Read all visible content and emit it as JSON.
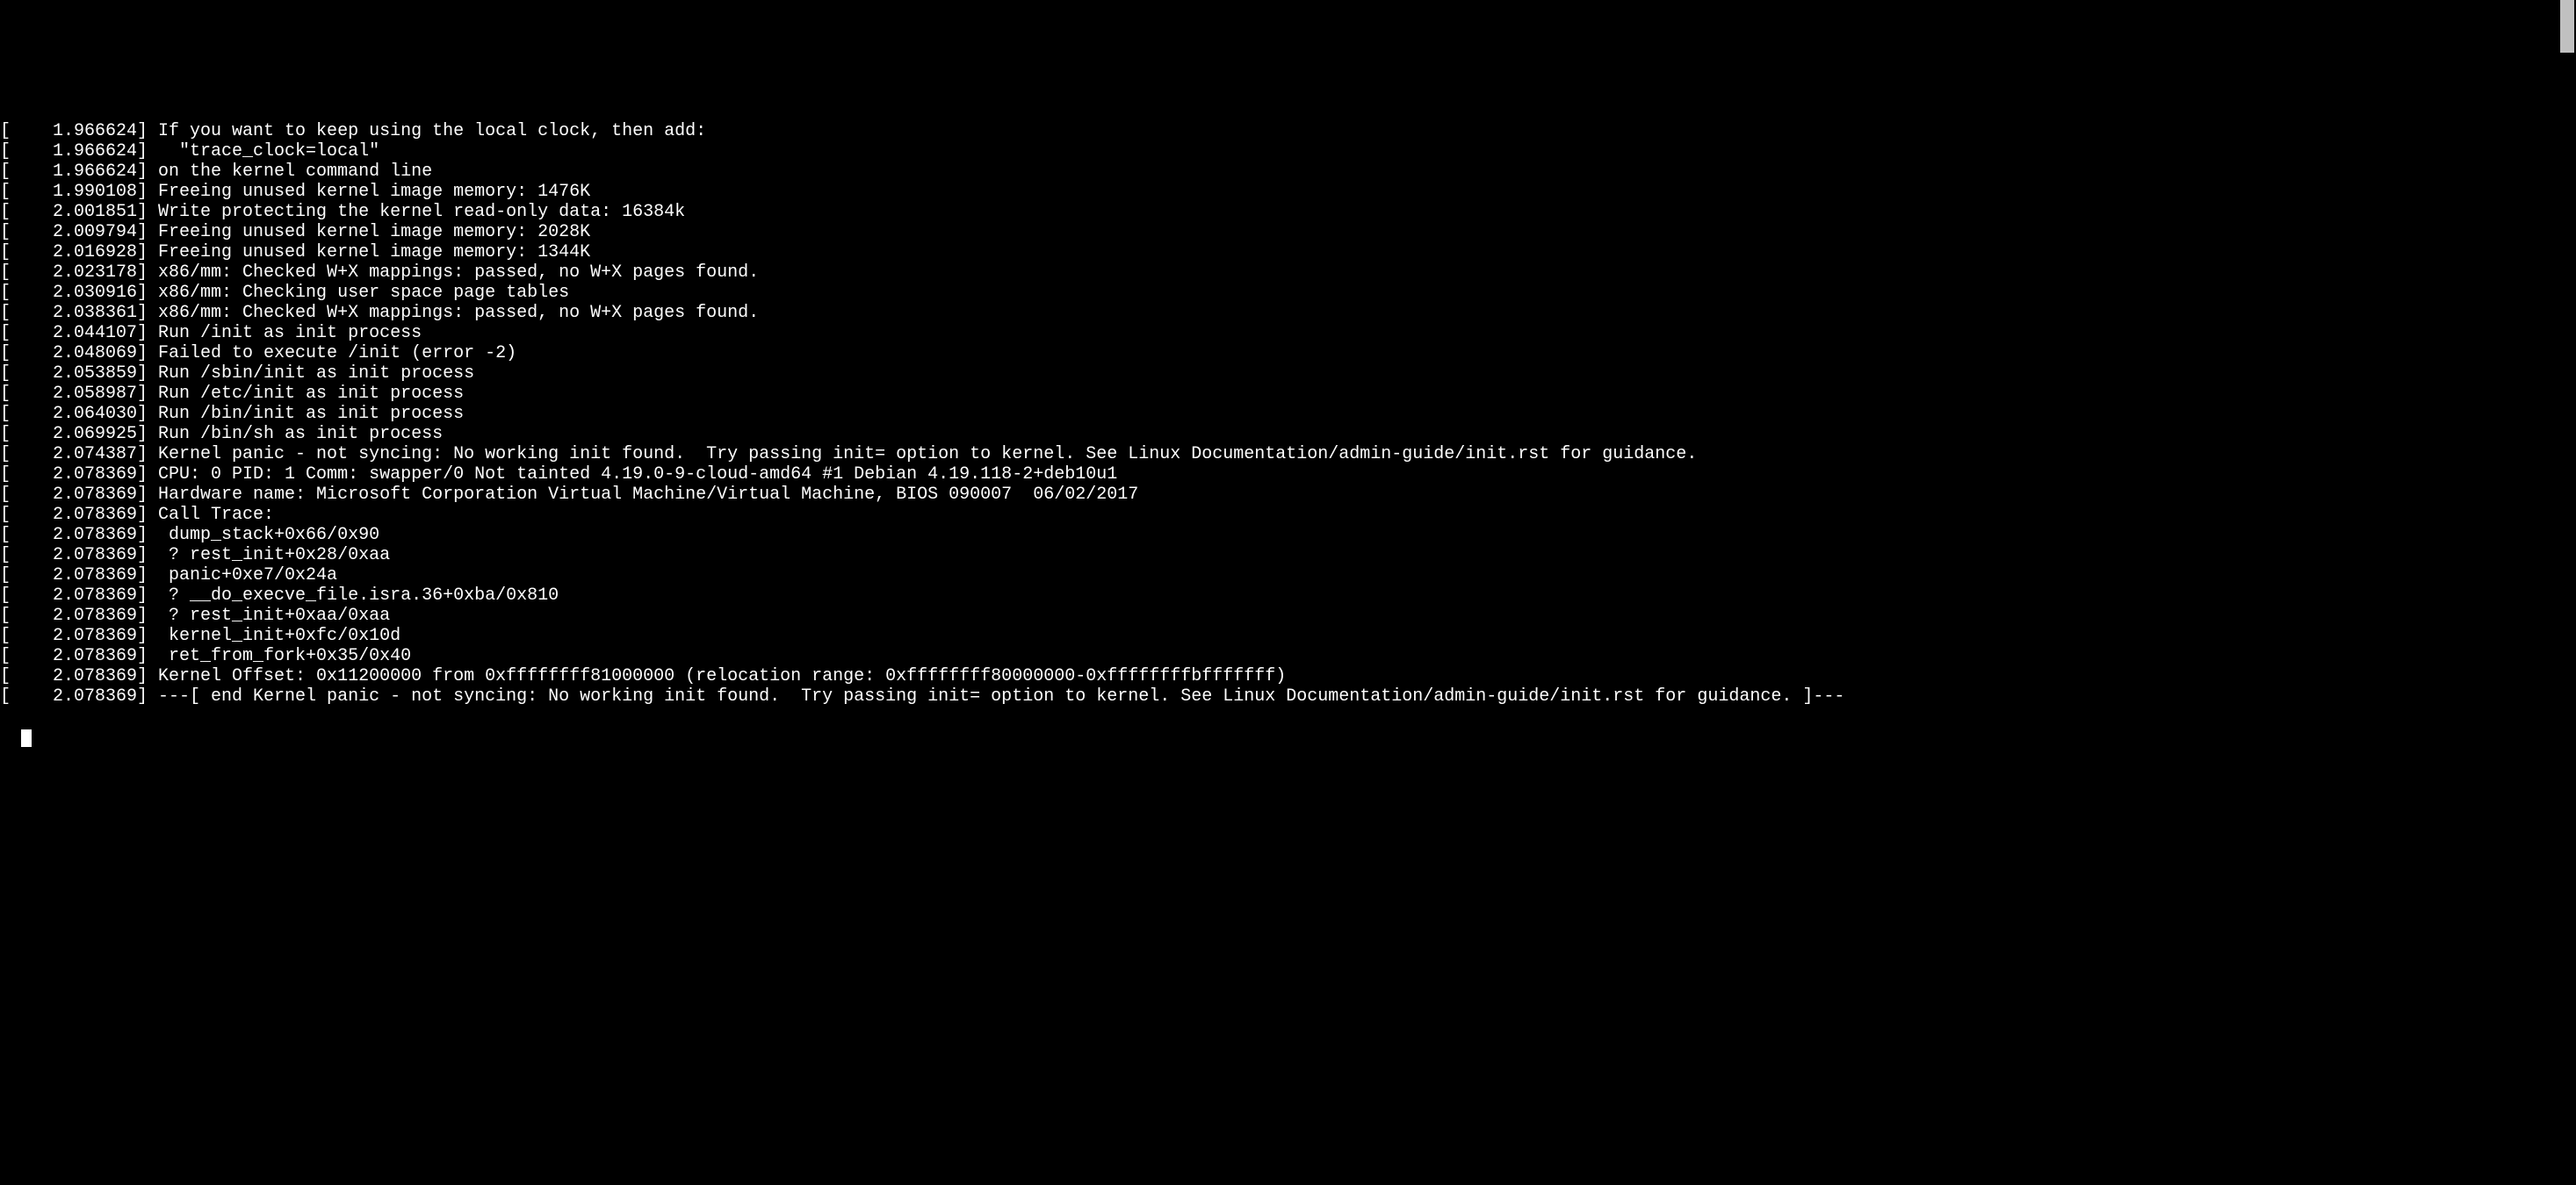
{
  "lines": [
    "[    1.966624] If you want to keep using the local clock, then add:",
    "[    1.966624]   \"trace_clock=local\"",
    "[    1.966624] on the kernel command line",
    "[    1.990108] Freeing unused kernel image memory: 1476K",
    "[    2.001851] Write protecting the kernel read-only data: 16384k",
    "[    2.009794] Freeing unused kernel image memory: 2028K",
    "[    2.016928] Freeing unused kernel image memory: 1344K",
    "[    2.023178] x86/mm: Checked W+X mappings: passed, no W+X pages found.",
    "[    2.030916] x86/mm: Checking user space page tables",
    "[    2.038361] x86/mm: Checked W+X mappings: passed, no W+X pages found.",
    "[    2.044107] Run /init as init process",
    "[    2.048069] Failed to execute /init (error -2)",
    "[    2.053859] Run /sbin/init as init process",
    "[    2.058987] Run /etc/init as init process",
    "[    2.064030] Run /bin/init as init process",
    "[    2.069925] Run /bin/sh as init process",
    "[    2.074387] Kernel panic - not syncing: No working init found.  Try passing init= option to kernel. See Linux Documentation/admin-guide/init.rst for guidance.",
    "[    2.078369] CPU: 0 PID: 1 Comm: swapper/0 Not tainted 4.19.0-9-cloud-amd64 #1 Debian 4.19.118-2+deb10u1",
    "[    2.078369] Hardware name: Microsoft Corporation Virtual Machine/Virtual Machine, BIOS 090007  06/02/2017",
    "[    2.078369] Call Trace:",
    "[    2.078369]  dump_stack+0x66/0x90",
    "[    2.078369]  ? rest_init+0x28/0xaa",
    "[    2.078369]  panic+0xe7/0x24a",
    "[    2.078369]  ? __do_execve_file.isra.36+0xba/0x810",
    "[    2.078369]  ? rest_init+0xaa/0xaa",
    "[    2.078369]  kernel_init+0xfc/0x10d",
    "[    2.078369]  ret_from_fork+0x35/0x40",
    "[    2.078369] Kernel Offset: 0x11200000 from 0xffffffff81000000 (relocation range: 0xffffffff80000000-0xffffffffbfffffff)",
    "[    2.078369] ---[ end Kernel panic - not syncing: No working init found.  Try passing init= option to kernel. See Linux Documentation/admin-guide/init.rst for guidance. ]---"
  ]
}
